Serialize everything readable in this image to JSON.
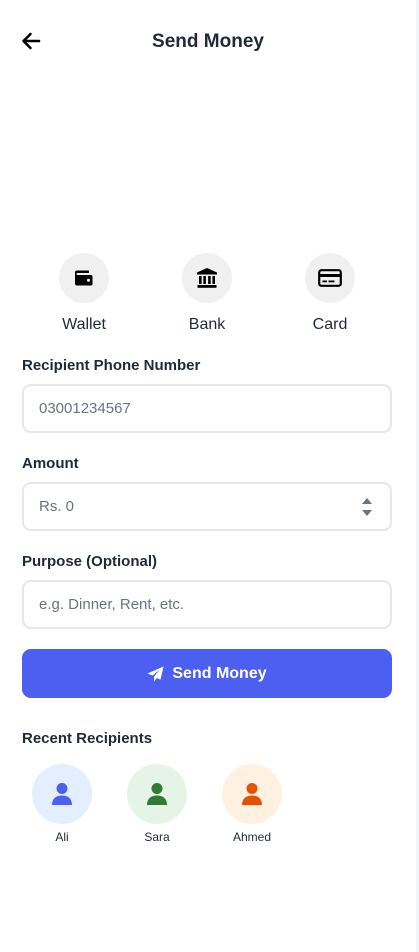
{
  "header": {
    "title": "Send Money",
    "back_icon": "arrow-left-icon"
  },
  "methods": [
    {
      "label": "Wallet",
      "icon": "wallet-icon"
    },
    {
      "label": "Bank",
      "icon": "bank-icon"
    },
    {
      "label": "Card",
      "icon": "credit-card-icon"
    }
  ],
  "form": {
    "phone": {
      "label": "Recipient Phone Number",
      "placeholder": "03001234567",
      "value": ""
    },
    "amount": {
      "label": "Amount",
      "placeholder": "Rs. 0",
      "value": ""
    },
    "purpose": {
      "label": "Purpose (Optional)",
      "placeholder": "e.g. Dinner, Rent, etc.",
      "value": ""
    },
    "submit": {
      "label": "Send Money",
      "icon": "paper-plane-icon"
    }
  },
  "recent": {
    "title": "Recent Recipients",
    "items": [
      {
        "name": "Ali",
        "icon": "user-icon",
        "icon_color": "#4c5ff0",
        "bg_color": "#e3efff"
      },
      {
        "name": "Sara",
        "icon": "user-icon",
        "icon_color": "#2e7d32",
        "bg_color": "#e6f4e7"
      },
      {
        "name": "Ahmed",
        "icon": "user-icon",
        "icon_color": "#e65100",
        "bg_color": "#fff1e1"
      }
    ]
  },
  "colors": {
    "primary": "#4c5ff0",
    "text": "#1f2937",
    "placeholder": "#6b7280",
    "border": "#e5e7eb"
  }
}
